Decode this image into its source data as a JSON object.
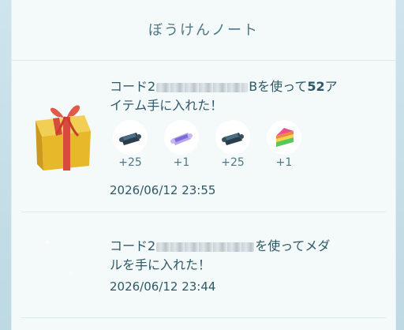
{
  "header": {
    "title": "ぼうけんノート"
  },
  "entries": [
    {
      "prefix": "コード2",
      "middle": "B",
      "text_after_code": "を使って",
      "count": "52",
      "text_after_count": "ア",
      "line2": "イテム手に入れた！",
      "items": [
        {
          "icon": "map-scroll-icon",
          "count": "+25"
        },
        {
          "icon": "glowing-scroll-icon",
          "count": "+1"
        },
        {
          "icon": "map-scroll-icon",
          "count": "+25"
        },
        {
          "icon": "rainbow-cake-icon",
          "count": "+1"
        }
      ],
      "timestamp": "2026/06/12 23:55"
    },
    {
      "prefix": "コード2",
      "text_after_code": "を使ってメダ",
      "line2": "ルを手に入れた！",
      "timestamp": "2026/06/12 23:44"
    }
  ],
  "colors": {
    "background": "#c5dee8",
    "panel": "#f4f9fa",
    "text": "#2f5866",
    "gift_gold": "#e6b82a",
    "gift_ribbon": "#d84b3c"
  }
}
